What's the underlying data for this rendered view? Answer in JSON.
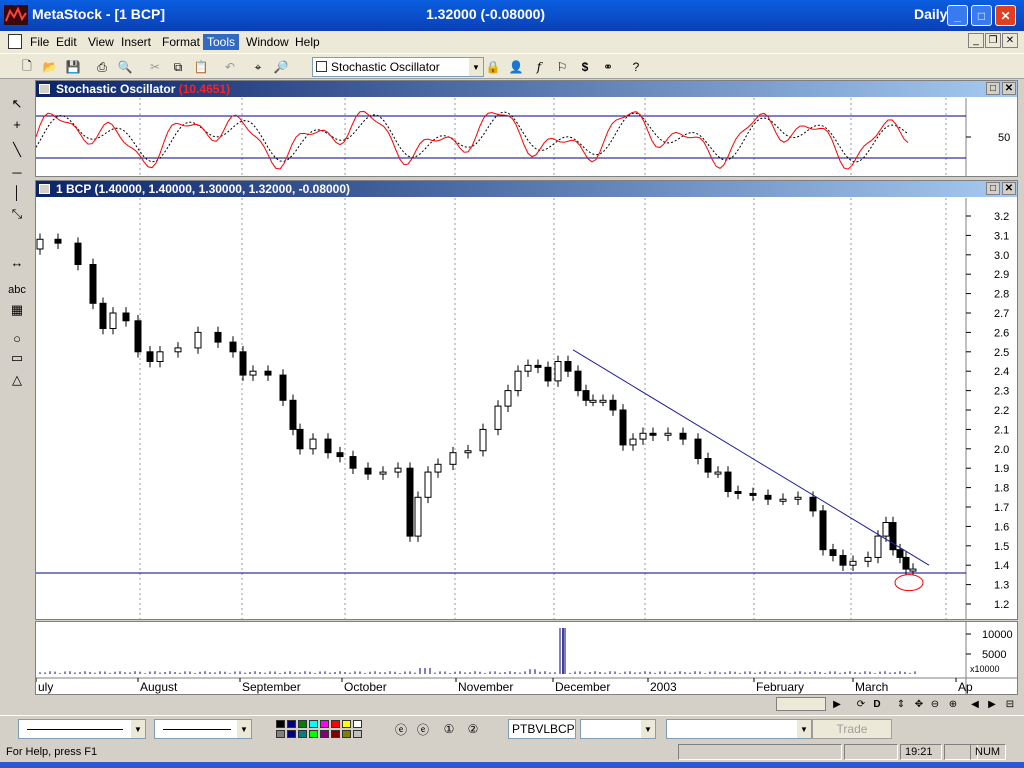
{
  "window": {
    "title": "MetaStock - [1 BCP]",
    "price_readout": "1.32000 (-0.08000)",
    "period": "Daily"
  },
  "menu": [
    "File",
    "Edit",
    "View",
    "Insert",
    "Format",
    "Tools",
    "Window",
    "Help"
  ],
  "menu_active": "Tools",
  "toolbar": {
    "indicator_select": "Stochastic Oscillator"
  },
  "left_tools": {
    "text_tool": "abc"
  },
  "stochastic_panel": {
    "title": "Stochastic Oscillator",
    "value": "(10.4651)",
    "y_tick": "50"
  },
  "price_panel": {
    "title": "1 BCP",
    "ohlc": "(1.40000, 1.40000, 1.30000, 1.32000, -0.08000)",
    "y_ticks": [
      "3.2",
      "3.1",
      "3.0",
      "2.9",
      "2.8",
      "2.7",
      "2.6",
      "2.5",
      "2.4",
      "2.3",
      "2.2",
      "2.1",
      "2.0",
      "1.9",
      "1.8",
      "1.7",
      "1.6",
      "1.5",
      "1.4",
      "1.3",
      "1.2"
    ]
  },
  "volume_panel": {
    "y_ticks": [
      "10000",
      "5000"
    ],
    "scale_label": "x10000"
  },
  "x_axis": {
    "labels": [
      "uly",
      "August",
      "September",
      "October",
      "November",
      "December",
      "2003",
      "February",
      "March",
      "Ap"
    ]
  },
  "scroll_controls": [
    "D"
  ],
  "bottom_bar": {
    "security_field": "PTBVLBCP",
    "trade_button": "Trade"
  },
  "colors": {
    "stoch_k": "#ff0000",
    "stoch_d": "#000000",
    "trendline": "#2020a0",
    "support_line": "#000080",
    "grid": "#999999",
    "highlight_circle": "#ff0000"
  },
  "status": {
    "help": "For Help, press F1",
    "time": "19:21",
    "num": "NUM"
  }
}
